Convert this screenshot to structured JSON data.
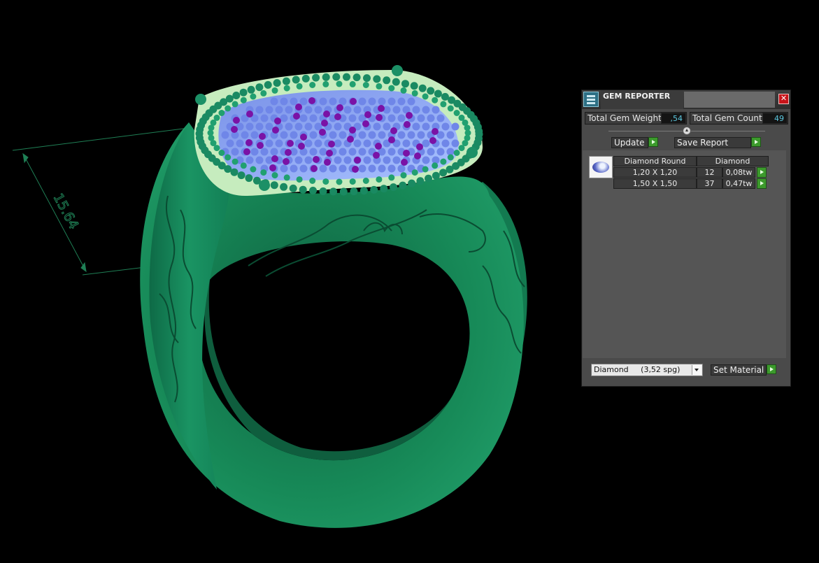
{
  "viewport": {
    "dimension_label": "15.64"
  },
  "panel": {
    "title": "GEM REPORTER",
    "total_weight_label": "Total Gem Weight",
    "total_weight_value": ",54",
    "total_count_label": "Total Gem Count",
    "total_count_value": "49",
    "update_label": "Update",
    "save_label": "Save Report",
    "table": {
      "headers": [
        "Diamond Round",
        "Diamond"
      ],
      "rows": [
        {
          "size": "1,20 X 1,20",
          "count": "12",
          "weight": "0,08tw"
        },
        {
          "size": "1,50 X 1,50",
          "count": "37",
          "weight": "0,47tw"
        }
      ]
    },
    "material_value": "Diamond     (3,52 spg)",
    "set_material_label": "Set Material"
  },
  "colors": {
    "metal": "#137a50",
    "metal_light": "#c6ecbe",
    "small_diamond": "#6f86e8",
    "purple_gem": "#7a12a6",
    "accent_green": "#3c9a2c",
    "value_text": "#5cc8e0"
  }
}
